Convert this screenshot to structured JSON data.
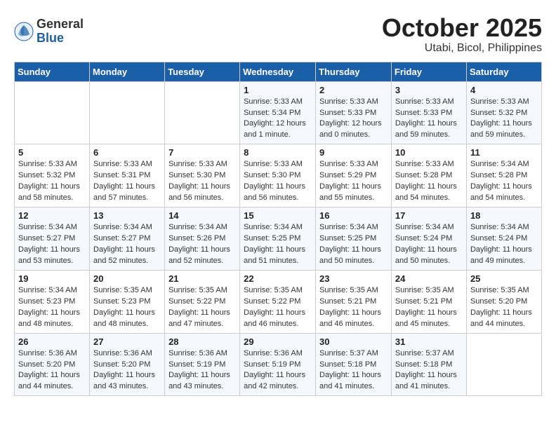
{
  "header": {
    "logo_general": "General",
    "logo_blue": "Blue",
    "month_title": "October 2025",
    "location": "Utabi, Bicol, Philippines"
  },
  "days_of_week": [
    "Sunday",
    "Monday",
    "Tuesday",
    "Wednesday",
    "Thursday",
    "Friday",
    "Saturday"
  ],
  "weeks": [
    [
      {
        "day": "",
        "info": ""
      },
      {
        "day": "",
        "info": ""
      },
      {
        "day": "",
        "info": ""
      },
      {
        "day": "1",
        "info": "Sunrise: 5:33 AM\nSunset: 5:34 PM\nDaylight: 12 hours\nand 1 minute."
      },
      {
        "day": "2",
        "info": "Sunrise: 5:33 AM\nSunset: 5:33 PM\nDaylight: 12 hours\nand 0 minutes."
      },
      {
        "day": "3",
        "info": "Sunrise: 5:33 AM\nSunset: 5:33 PM\nDaylight: 11 hours\nand 59 minutes."
      },
      {
        "day": "4",
        "info": "Sunrise: 5:33 AM\nSunset: 5:32 PM\nDaylight: 11 hours\nand 59 minutes."
      }
    ],
    [
      {
        "day": "5",
        "info": "Sunrise: 5:33 AM\nSunset: 5:32 PM\nDaylight: 11 hours\nand 58 minutes."
      },
      {
        "day": "6",
        "info": "Sunrise: 5:33 AM\nSunset: 5:31 PM\nDaylight: 11 hours\nand 57 minutes."
      },
      {
        "day": "7",
        "info": "Sunrise: 5:33 AM\nSunset: 5:30 PM\nDaylight: 11 hours\nand 56 minutes."
      },
      {
        "day": "8",
        "info": "Sunrise: 5:33 AM\nSunset: 5:30 PM\nDaylight: 11 hours\nand 56 minutes."
      },
      {
        "day": "9",
        "info": "Sunrise: 5:33 AM\nSunset: 5:29 PM\nDaylight: 11 hours\nand 55 minutes."
      },
      {
        "day": "10",
        "info": "Sunrise: 5:33 AM\nSunset: 5:28 PM\nDaylight: 11 hours\nand 54 minutes."
      },
      {
        "day": "11",
        "info": "Sunrise: 5:34 AM\nSunset: 5:28 PM\nDaylight: 11 hours\nand 54 minutes."
      }
    ],
    [
      {
        "day": "12",
        "info": "Sunrise: 5:34 AM\nSunset: 5:27 PM\nDaylight: 11 hours\nand 53 minutes."
      },
      {
        "day": "13",
        "info": "Sunrise: 5:34 AM\nSunset: 5:27 PM\nDaylight: 11 hours\nand 52 minutes."
      },
      {
        "day": "14",
        "info": "Sunrise: 5:34 AM\nSunset: 5:26 PM\nDaylight: 11 hours\nand 52 minutes."
      },
      {
        "day": "15",
        "info": "Sunrise: 5:34 AM\nSunset: 5:25 PM\nDaylight: 11 hours\nand 51 minutes."
      },
      {
        "day": "16",
        "info": "Sunrise: 5:34 AM\nSunset: 5:25 PM\nDaylight: 11 hours\nand 50 minutes."
      },
      {
        "day": "17",
        "info": "Sunrise: 5:34 AM\nSunset: 5:24 PM\nDaylight: 11 hours\nand 50 minutes."
      },
      {
        "day": "18",
        "info": "Sunrise: 5:34 AM\nSunset: 5:24 PM\nDaylight: 11 hours\nand 49 minutes."
      }
    ],
    [
      {
        "day": "19",
        "info": "Sunrise: 5:34 AM\nSunset: 5:23 PM\nDaylight: 11 hours\nand 48 minutes."
      },
      {
        "day": "20",
        "info": "Sunrise: 5:35 AM\nSunset: 5:23 PM\nDaylight: 11 hours\nand 48 minutes."
      },
      {
        "day": "21",
        "info": "Sunrise: 5:35 AM\nSunset: 5:22 PM\nDaylight: 11 hours\nand 47 minutes."
      },
      {
        "day": "22",
        "info": "Sunrise: 5:35 AM\nSunset: 5:22 PM\nDaylight: 11 hours\nand 46 minutes."
      },
      {
        "day": "23",
        "info": "Sunrise: 5:35 AM\nSunset: 5:21 PM\nDaylight: 11 hours\nand 46 minutes."
      },
      {
        "day": "24",
        "info": "Sunrise: 5:35 AM\nSunset: 5:21 PM\nDaylight: 11 hours\nand 45 minutes."
      },
      {
        "day": "25",
        "info": "Sunrise: 5:35 AM\nSunset: 5:20 PM\nDaylight: 11 hours\nand 44 minutes."
      }
    ],
    [
      {
        "day": "26",
        "info": "Sunrise: 5:36 AM\nSunset: 5:20 PM\nDaylight: 11 hours\nand 44 minutes."
      },
      {
        "day": "27",
        "info": "Sunrise: 5:36 AM\nSunset: 5:20 PM\nDaylight: 11 hours\nand 43 minutes."
      },
      {
        "day": "28",
        "info": "Sunrise: 5:36 AM\nSunset: 5:19 PM\nDaylight: 11 hours\nand 43 minutes."
      },
      {
        "day": "29",
        "info": "Sunrise: 5:36 AM\nSunset: 5:19 PM\nDaylight: 11 hours\nand 42 minutes."
      },
      {
        "day": "30",
        "info": "Sunrise: 5:37 AM\nSunset: 5:18 PM\nDaylight: 11 hours\nand 41 minutes."
      },
      {
        "day": "31",
        "info": "Sunrise: 5:37 AM\nSunset: 5:18 PM\nDaylight: 11 hours\nand 41 minutes."
      },
      {
        "day": "",
        "info": ""
      }
    ]
  ]
}
